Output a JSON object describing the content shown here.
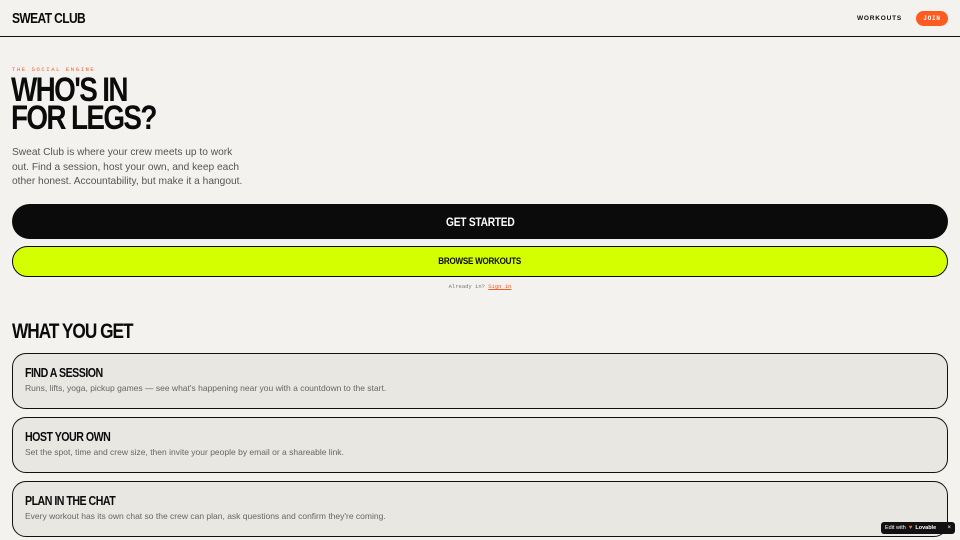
{
  "header": {
    "logo": "SWEAT CLUB",
    "nav_workouts": "WORKOUTS",
    "join_label": "JOIN"
  },
  "hero": {
    "eyebrow": "THE SOCIAL ENGINE",
    "title_line1": "WHO'S IN",
    "title_line2": "FOR LEGS?",
    "description": "Sweat Club is where your crew meets up to work out. Find a session, host your own, and keep each other honest. Accountability, but make it a hangout.",
    "get_started_label": "GET STARTED",
    "browse_label": "BROWSE WORKOUTS",
    "already_in": "Already in?",
    "sign_in_label": "Sign in"
  },
  "features": {
    "title": "WHAT YOU GET",
    "cards": [
      {
        "title": "FIND A SESSION",
        "desc": "Runs, lifts, yoga, pickup games — see what's happening near you with a countdown to the start."
      },
      {
        "title": "HOST YOUR OWN",
        "desc": "Set the spot, time and crew size, then invite your people by email or a shareable link."
      },
      {
        "title": "PLAN IN THE CHAT",
        "desc": "Every workout has its own chat so the crew can plan, ask questions and confirm they're coming."
      }
    ]
  },
  "badge": {
    "edit_with": "Edit with",
    "brand": "Lovable",
    "close": "×"
  },
  "colors": {
    "accent_orange": "#ff5a1f",
    "accent_lime": "#d4ff00",
    "background": "#f3f2ee",
    "ink": "#0b0b0b"
  }
}
